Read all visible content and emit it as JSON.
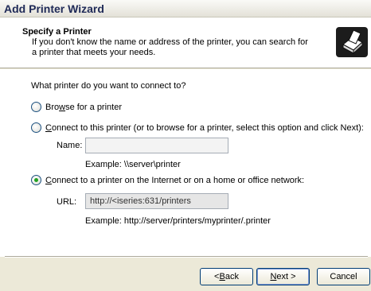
{
  "window": {
    "title": "Add Printer Wizard"
  },
  "header": {
    "title": "Specify a Printer",
    "subtitle": "If you don't know the name or address of the printer, you can search for a printer that meets your needs.",
    "icon": "printer-icon"
  },
  "main": {
    "question": "What printer do you want to connect to?",
    "options": [
      {
        "accel": "w",
        "pre": "Bro",
        "post": "se for a printer",
        "checked": false
      },
      {
        "accel": "C",
        "pre": "",
        "post": "onnect to this printer (or to browse for a printer, select this option and click Next):",
        "checked": false
      },
      {
        "accel": "C",
        "pre": "",
        "post": "onnect to a printer on the Internet or on a home or office network:",
        "checked": true
      }
    ],
    "name_label": "Name:",
    "name_value": "",
    "name_example": "Example: \\\\server\\printer",
    "url_label": "URL:",
    "url_value": "http://<iseries:631/printers",
    "url_example": "Example: http://server/printers/myprinter/.printer"
  },
  "buttons": {
    "back": {
      "accel": "B",
      "pre": "< ",
      "post": "ack"
    },
    "next": {
      "accel": "N",
      "pre": "",
      "post": "ext >"
    },
    "cancel": "Cancel"
  }
}
